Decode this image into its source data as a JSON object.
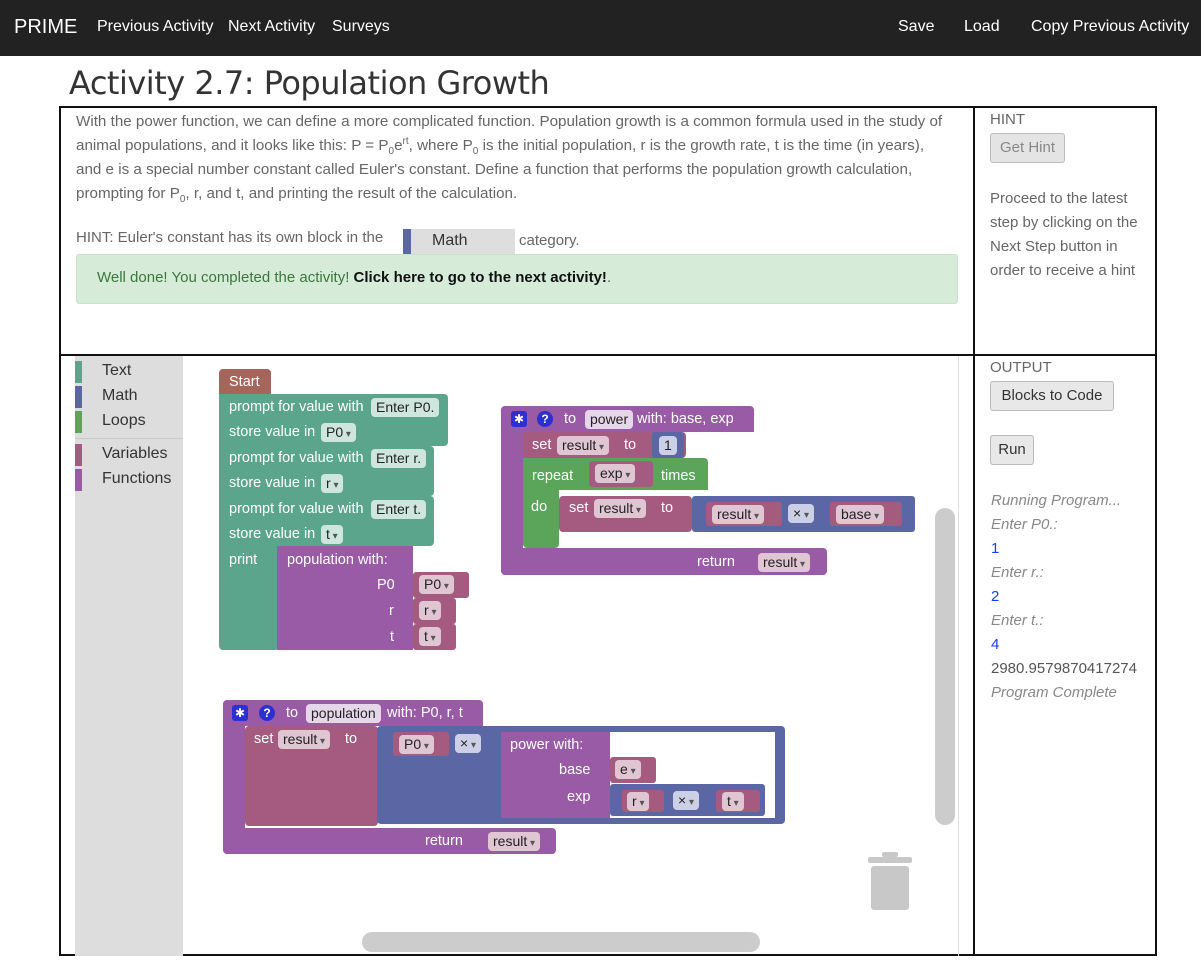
{
  "nav": {
    "brand": "PRIME",
    "previous": "Previous Activity",
    "next": "Next Activity",
    "surveys": "Surveys",
    "save": "Save",
    "load": "Load",
    "copy": "Copy Previous Activity"
  },
  "title": "Activity 2.7: Population Growth",
  "instructions": {
    "p1": "With the power function, we can define a more complicated function. Population growth is a common formula used in the study of animal populations, and it looks like this: P = P",
    "p1_sub": "0",
    "p1_mid": "e",
    "p1_sup": "rt",
    "p1_b": ", where P",
    "p1_b_sub": "0",
    "p1_c": " is the initial population, r is the growth rate, t is the time (in years), and e is a special number constant called Euler's constant. Define a function that performs the population growth calculation, prompting for P",
    "p1_c_sub": "0",
    "p1_d": ", r, and t, and printing the result of the calculation.",
    "hint_prefix": "HINT: Euler's constant has its own block in the",
    "hint_chip": "Math",
    "hint_suffix": "category.",
    "success_text": "Well done! You completed the activity! ",
    "success_link": "Click here to go to the next activity!",
    "success_end": "."
  },
  "hint": {
    "title": "HINT",
    "button": "Get Hint",
    "message": "Proceed to the latest step by clicking on the Next Step button in order to receive a hint"
  },
  "output": {
    "title": "OUTPUT",
    "blocks_to_code": "Blocks to Code",
    "run": "Run",
    "lines": [
      {
        "text": "Running Program...",
        "style": "i"
      },
      {
        "text": "Enter P0.:",
        "style": "i"
      },
      {
        "text": "1",
        "style": "blue"
      },
      {
        "text": "Enter r.:",
        "style": "i"
      },
      {
        "text": "2",
        "style": "blue"
      },
      {
        "text": "Enter t.:",
        "style": "i"
      },
      {
        "text": "4",
        "style": "blue"
      },
      {
        "text": "2980.9579870417274",
        "style": "plain"
      },
      {
        "text": "Program Complete",
        "style": "i"
      }
    ]
  },
  "toolbox": {
    "categories": [
      {
        "label": "Text",
        "color": "#5ba58c"
      },
      {
        "label": "Math",
        "color": "#5b67a5"
      },
      {
        "label": "Loops",
        "color": "#5ba55b"
      },
      {
        "label": "Variables",
        "color": "#a55b80"
      },
      {
        "label": "Functions",
        "color": "#995ba5"
      }
    ]
  },
  "blocks": {
    "start": "Start",
    "prompt1": "prompt for value with",
    "prompt1_text": "Enter P0.",
    "store1": "store value in",
    "store1_var": "P0",
    "prompt2": "prompt for value with",
    "prompt2_text": "Enter r.",
    "store2": "store value in",
    "store2_var": "r",
    "prompt3": "prompt for value with",
    "prompt3_text": "Enter t.",
    "store3": "store value in",
    "store3_var": "t",
    "print": "print",
    "call_pop": "population  with:",
    "arg_p0": "P0",
    "arg_r": "r",
    "arg_t": "t",
    "val_p0": "P0",
    "val_r": "r",
    "val_t": "t",
    "power_to": "to",
    "power_name": "power",
    "power_with": "with: base, exp",
    "set": "set",
    "result": "result",
    "to": "to",
    "one": "1",
    "repeat": "repeat",
    "exp": "exp",
    "times": "times",
    "do": "do",
    "set2": "set",
    "result2": "result",
    "to2": "to",
    "mul_result": "result",
    "mul_op": "×",
    "mul_base": "base",
    "return1": "return",
    "return1_var": "result",
    "pop_to": "to",
    "pop_name": "population",
    "pop_with": "with: P0, r, t",
    "pop_set": "set",
    "pop_result": "result",
    "pop_to2": "to",
    "pop_p0": "P0",
    "pop_op": "×",
    "pow_call": "power  with:",
    "pow_base": "base",
    "pow_e": "e",
    "pow_exp": "exp",
    "pow_r": "r",
    "pow_op2": "×",
    "pow_t": "t",
    "return2": "return",
    "return2_var": "result"
  },
  "colors": {
    "text_block": "#5ba58c",
    "math_block": "#5b67a5",
    "loop_block": "#5ba55b",
    "var_block": "#a55b80",
    "proc_block": "#995ba5",
    "start_block": "#a5655b"
  }
}
